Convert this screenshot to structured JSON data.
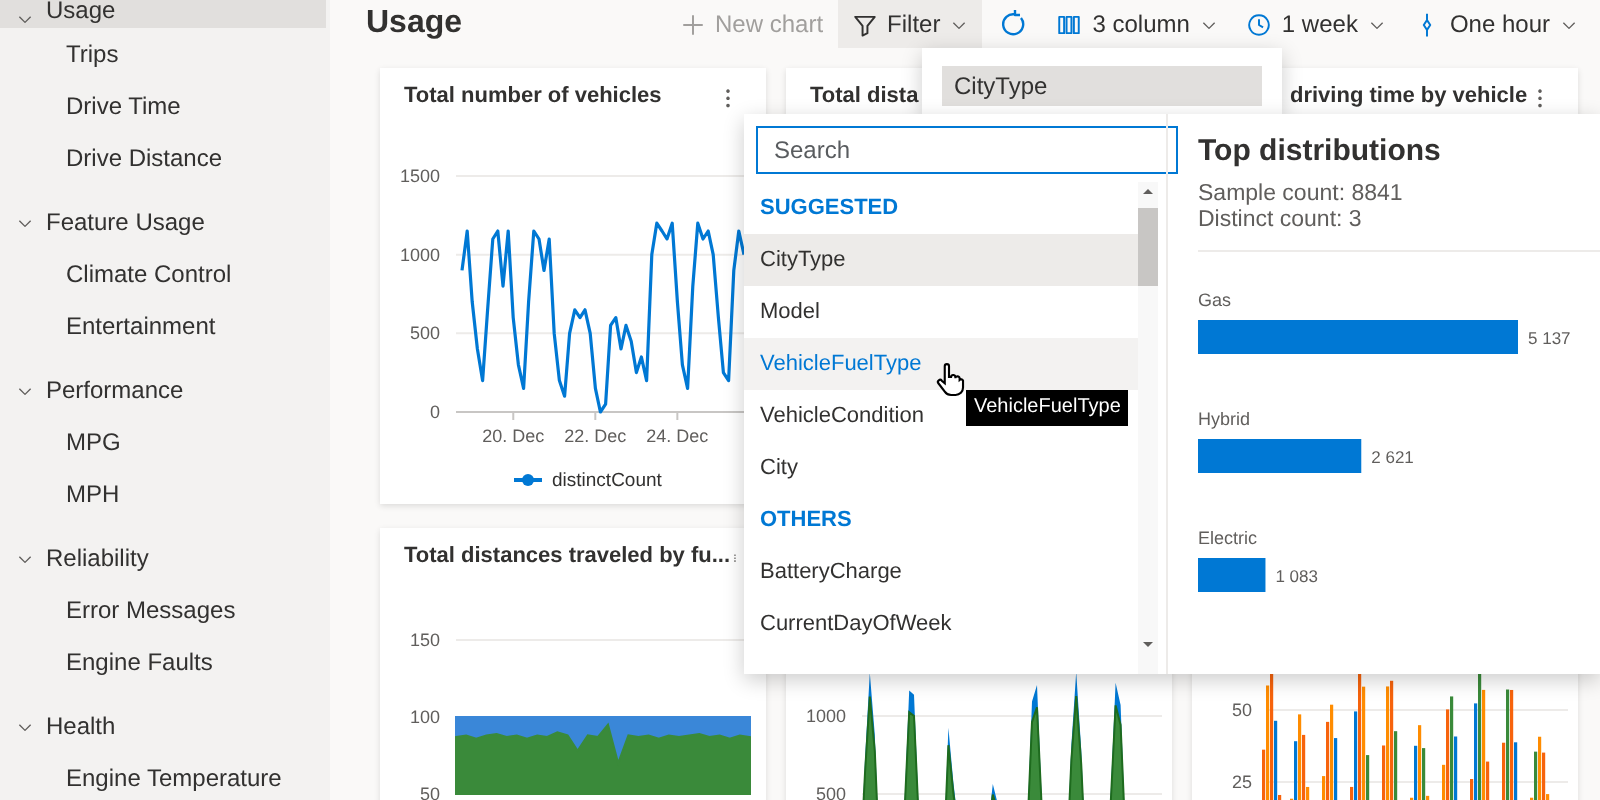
{
  "sidebar": {
    "items": [
      {
        "label": "Usage",
        "expanded": true,
        "selected": true,
        "children": [
          {
            "label": "Trips",
            "selected": false
          },
          {
            "label": "Drive Time",
            "selected": false
          },
          {
            "label": "Drive Distance",
            "selected": false
          }
        ]
      },
      {
        "label": "Feature Usage",
        "expanded": true,
        "selected": false,
        "children": [
          {
            "label": "Climate Control",
            "selected": false
          },
          {
            "label": "Entertainment",
            "selected": false
          }
        ]
      },
      {
        "label": "Performance",
        "expanded": true,
        "selected": false,
        "children": [
          {
            "label": "MPG",
            "selected": false
          },
          {
            "label": "MPH",
            "selected": false
          }
        ]
      },
      {
        "label": "Reliability",
        "expanded": true,
        "selected": false,
        "children": [
          {
            "label": "Error Messages",
            "selected": false
          },
          {
            "label": "Engine Faults",
            "selected": false
          }
        ]
      },
      {
        "label": "Health",
        "expanded": true,
        "selected": false,
        "children": [
          {
            "label": "Engine Temperature",
            "selected": false
          }
        ]
      }
    ]
  },
  "page_title": "Usage",
  "toolbar": [
    {
      "kind": "add",
      "label": "New chart",
      "disabled": true
    },
    {
      "kind": "filter",
      "label": "Filter",
      "disabled": false,
      "expanded": true
    },
    {
      "kind": "refresh",
      "disabled": false
    },
    {
      "kind": "columns",
      "label": "3 column",
      "disabled": false,
      "expanded": false
    },
    {
      "kind": "time",
      "label": "1 week",
      "disabled": false,
      "expanded": false
    },
    {
      "kind": "interval",
      "label": "One hour",
      "disabled": false,
      "expanded": false
    }
  ],
  "cards": [
    {
      "kind": "chart",
      "title": "Total number of vehicles",
      "more_menu": true,
      "chart_data": {
        "type": "line",
        "categories": [
          null,
          null,
          null,
          null,
          null,
          null,
          null,
          null,
          null,
          null,
          "20. Dec",
          null,
          null,
          null,
          null,
          null,
          null,
          null,
          null,
          null,
          null,
          null,
          null,
          null,
          null,
          null,
          "22. Dec",
          null,
          null,
          null,
          null,
          null,
          null,
          null,
          null,
          null,
          null,
          null,
          null,
          null,
          null,
          null,
          "24. Dec",
          null,
          null,
          null,
          null,
          null,
          null,
          null,
          null,
          null,
          null,
          null,
          null,
          null
        ],
        "ylim": [
          0,
          1500
        ],
        "yticks": [
          0,
          500,
          1000,
          1500
        ],
        "series": [
          {
            "name": "distinctCount",
            "color": "#0078d4",
            "values": [
              900,
              1150,
              700,
              400,
              200,
              650,
              1100,
              1150,
              800,
              1150,
              600,
              300,
              150,
              700,
              1150,
              1100,
              900,
              1100,
              500,
              200,
              100,
              500,
              650,
              600,
              650,
              500,
              150,
              0,
              50,
              550,
              600,
              400,
              550,
              450,
              250,
              350,
              200,
              1000,
              1200,
              1150,
              1100,
              1200,
              700,
              300,
              150,
              800,
              1200,
              1100,
              1150,
              1000,
              600,
              250,
              200,
              900,
              1150,
              1000
            ]
          }
        ]
      }
    },
    {
      "kind": "hidden",
      "title": "Total dista",
      "more_menu": false
    },
    {
      "kind": "hidden",
      "title": "driving time by vehicle",
      "more_menu": true
    },
    {
      "kind": "chart",
      "title": "Total distances traveled by fu...",
      "more_menu": true,
      "chart_data": {
        "type": "area",
        "stacked": false,
        "ylim": [
          50,
          150
        ],
        "yticks": [
          50,
          100,
          150
        ],
        "series": [
          {
            "color": "#3a87d8",
            "values": [
              100,
              100,
              100,
              100,
              100,
              100,
              100,
              100,
              100,
              100,
              100,
              100,
              100,
              100,
              100,
              100,
              100,
              100,
              100,
              100,
              100,
              100,
              100,
              100,
              100,
              100,
              100,
              100,
              100,
              100
            ]
          },
          {
            "color": "#3a8a3a",
            "values": [
              87,
              88,
              86,
              88,
              89,
              87,
              88,
              86,
              88,
              87,
              90,
              88,
              78,
              88,
              87,
              95,
              70,
              88,
              87,
              88,
              86,
              88,
              87,
              88,
              89,
              87,
              88,
              86,
              88,
              87
            ]
          }
        ]
      }
    },
    {
      "kind": "area_picture",
      "more_menu": false,
      "axis_labels": [
        "1000",
        "500"
      ]
    },
    {
      "kind": "bars_picture",
      "more_menu": false,
      "axis_labels": [
        "50",
        "25"
      ]
    }
  ],
  "filter_dropdown": {
    "items": [
      {
        "label": "CityType",
        "selected": true
      }
    ]
  },
  "field_picker": {
    "search": {
      "placeholder": "Search"
    },
    "list": [
      {
        "kind": "header",
        "label": "SUGGESTED"
      },
      {
        "kind": "item",
        "label": "CityType",
        "selected": true,
        "hovered": false
      },
      {
        "kind": "item",
        "label": "Model",
        "selected": false,
        "hovered": false
      },
      {
        "kind": "item",
        "label": "VehicleFuelType",
        "selected": false,
        "hovered": true
      },
      {
        "kind": "item",
        "label": "VehicleCondition",
        "selected": false,
        "hovered": false
      },
      {
        "kind": "item",
        "label": "City",
        "selected": false,
        "hovered": false
      },
      {
        "kind": "header",
        "label": "OTHERS"
      },
      {
        "kind": "item",
        "label": "BatteryCharge",
        "selected": false,
        "hovered": false
      },
      {
        "kind": "item",
        "label": "CurrentDayOfWeek",
        "selected": false,
        "hovered": false
      }
    ]
  },
  "distribution": {
    "title": "Top distributions",
    "sample_count": "Sample count: 8841",
    "distinct_count": "Distinct count: 3",
    "chart_data": {
      "type": "bar",
      "orientation": "horizontal",
      "categories": [
        "Gas",
        "Hybrid",
        "Electric"
      ],
      "data_labels": true,
      "series": [
        {
          "color": "#0078d4",
          "values": [
            5137,
            2621,
            1083
          ]
        }
      ]
    }
  },
  "tooltip": "VehicleFuelType"
}
